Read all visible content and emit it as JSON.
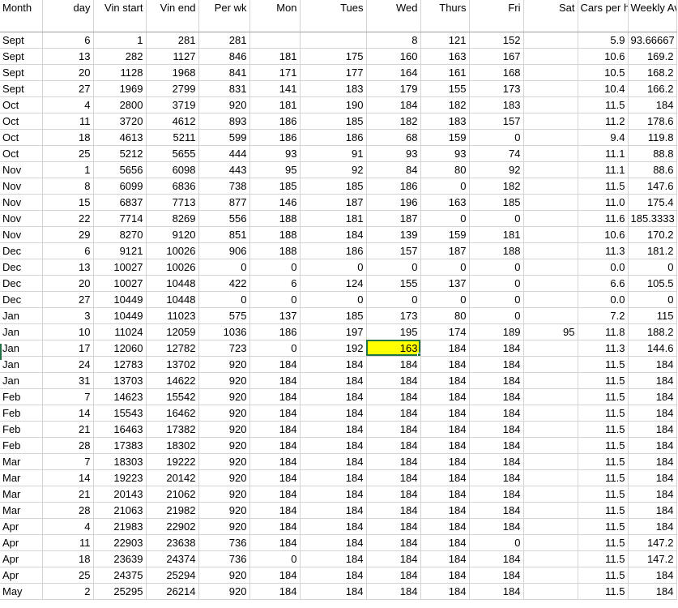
{
  "headers": [
    "Month",
    "day",
    "Vin start",
    "Vin end",
    "Per wk",
    "Mon",
    "Tues",
    "Wed",
    "Thurs",
    "Fri",
    "Sat",
    "Cars per hour",
    "Weekly Average"
  ],
  "rows": [
    [
      "Sept",
      "6",
      "1",
      "281",
      "281",
      "",
      "",
      "8",
      "121",
      "152",
      "",
      "5.9",
      "93.66667"
    ],
    [
      "Sept",
      "13",
      "282",
      "1127",
      "846",
      "181",
      "175",
      "160",
      "163",
      "167",
      "",
      "10.6",
      "169.2"
    ],
    [
      "Sept",
      "20",
      "1128",
      "1968",
      "841",
      "171",
      "177",
      "164",
      "161",
      "168",
      "",
      "10.5",
      "168.2"
    ],
    [
      "Sept",
      "27",
      "1969",
      "2799",
      "831",
      "141",
      "183",
      "179",
      "155",
      "173",
      "",
      "10.4",
      "166.2"
    ],
    [
      "Oct",
      "4",
      "2800",
      "3719",
      "920",
      "181",
      "190",
      "184",
      "182",
      "183",
      "",
      "11.5",
      "184"
    ],
    [
      "Oct",
      "11",
      "3720",
      "4612",
      "893",
      "186",
      "185",
      "182",
      "183",
      "157",
      "",
      "11.2",
      "178.6"
    ],
    [
      "Oct",
      "18",
      "4613",
      "5211",
      "599",
      "186",
      "186",
      "68",
      "159",
      "0",
      "",
      "9.4",
      "119.8"
    ],
    [
      "Oct",
      "25",
      "5212",
      "5655",
      "444",
      "93",
      "91",
      "93",
      "93",
      "74",
      "",
      "11.1",
      "88.8"
    ],
    [
      "Nov",
      "1",
      "5656",
      "6098",
      "443",
      "95",
      "92",
      "84",
      "80",
      "92",
      "",
      "11.1",
      "88.6"
    ],
    [
      "Nov",
      "8",
      "6099",
      "6836",
      "738",
      "185",
      "185",
      "186",
      "0",
      "182",
      "",
      "11.5",
      "147.6"
    ],
    [
      "Nov",
      "15",
      "6837",
      "7713",
      "877",
      "146",
      "187",
      "196",
      "163",
      "185",
      "",
      "11.0",
      "175.4"
    ],
    [
      "Nov",
      "22",
      "7714",
      "8269",
      "556",
      "188",
      "181",
      "187",
      "0",
      "0",
      "",
      "11.6",
      "185.3333"
    ],
    [
      "Nov",
      "29",
      "8270",
      "9120",
      "851",
      "188",
      "184",
      "139",
      "159",
      "181",
      "",
      "10.6",
      "170.2"
    ],
    [
      "Dec",
      "6",
      "9121",
      "10026",
      "906",
      "188",
      "186",
      "157",
      "187",
      "188",
      "",
      "11.3",
      "181.2"
    ],
    [
      "Dec",
      "13",
      "10027",
      "10026",
      "0",
      "0",
      "0",
      "0",
      "0",
      "0",
      "",
      "0.0",
      "0"
    ],
    [
      "Dec",
      "20",
      "10027",
      "10448",
      "422",
      "6",
      "124",
      "155",
      "137",
      "0",
      "",
      "6.6",
      "105.5"
    ],
    [
      "Dec",
      "27",
      "10449",
      "10448",
      "0",
      "0",
      "0",
      "0",
      "0",
      "0",
      "",
      "0.0",
      "0"
    ],
    [
      "Jan",
      "3",
      "10449",
      "11023",
      "575",
      "137",
      "185",
      "173",
      "80",
      "0",
      "",
      "7.2",
      "115"
    ],
    [
      "Jan",
      "10",
      "11024",
      "12059",
      "1036",
      "186",
      "197",
      "195",
      "174",
      "189",
      "95",
      "11.8",
      "188.2"
    ],
    [
      "Jan",
      "17",
      "12060",
      "12782",
      "723",
      "0",
      "192",
      "163",
      "184",
      "184",
      "",
      "11.3",
      "144.6"
    ],
    [
      "Jan",
      "24",
      "12783",
      "13702",
      "920",
      "184",
      "184",
      "184",
      "184",
      "184",
      "",
      "11.5",
      "184"
    ],
    [
      "Jan",
      "31",
      "13703",
      "14622",
      "920",
      "184",
      "184",
      "184",
      "184",
      "184",
      "",
      "11.5",
      "184"
    ],
    [
      "Feb",
      "7",
      "14623",
      "15542",
      "920",
      "184",
      "184",
      "184",
      "184",
      "184",
      "",
      "11.5",
      "184"
    ],
    [
      "Feb",
      "14",
      "15543",
      "16462",
      "920",
      "184",
      "184",
      "184",
      "184",
      "184",
      "",
      "11.5",
      "184"
    ],
    [
      "Feb",
      "21",
      "16463",
      "17382",
      "920",
      "184",
      "184",
      "184",
      "184",
      "184",
      "",
      "11.5",
      "184"
    ],
    [
      "Feb",
      "28",
      "17383",
      "18302",
      "920",
      "184",
      "184",
      "184",
      "184",
      "184",
      "",
      "11.5",
      "184"
    ],
    [
      "Mar",
      "7",
      "18303",
      "19222",
      "920",
      "184",
      "184",
      "184",
      "184",
      "184",
      "",
      "11.5",
      "184"
    ],
    [
      "Mar",
      "14",
      "19223",
      "20142",
      "920",
      "184",
      "184",
      "184",
      "184",
      "184",
      "",
      "11.5",
      "184"
    ],
    [
      "Mar",
      "21",
      "20143",
      "21062",
      "920",
      "184",
      "184",
      "184",
      "184",
      "184",
      "",
      "11.5",
      "184"
    ],
    [
      "Mar",
      "28",
      "21063",
      "21982",
      "920",
      "184",
      "184",
      "184",
      "184",
      "184",
      "",
      "11.5",
      "184"
    ],
    [
      "Apr",
      "4",
      "21983",
      "22902",
      "920",
      "184",
      "184",
      "184",
      "184",
      "184",
      "",
      "11.5",
      "184"
    ],
    [
      "Apr",
      "11",
      "22903",
      "23638",
      "736",
      "184",
      "184",
      "184",
      "184",
      "0",
      "",
      "11.5",
      "147.2"
    ],
    [
      "Apr",
      "18",
      "23639",
      "24374",
      "736",
      "0",
      "184",
      "184",
      "184",
      "184",
      "",
      "11.5",
      "147.2"
    ],
    [
      "Apr",
      "25",
      "24375",
      "25294",
      "920",
      "184",
      "184",
      "184",
      "184",
      "184",
      "",
      "11.5",
      "184"
    ],
    [
      "May",
      "2",
      "25295",
      "26214",
      "920",
      "184",
      "184",
      "184",
      "184",
      "184",
      "",
      "11.5",
      "184"
    ]
  ],
  "selected_cell": {
    "row": 19,
    "col": 7,
    "fill": "#ffff00"
  },
  "colors": {
    "gridline": "#d4d4d4",
    "selection": "#217346",
    "highlight": "#ffff00"
  }
}
